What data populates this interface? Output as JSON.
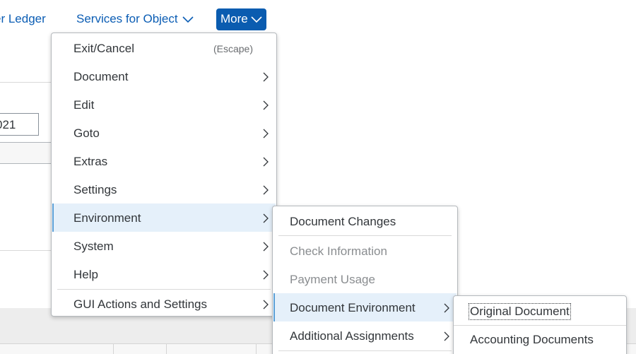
{
  "toolbar": {
    "ledger_link": "er Ledger",
    "services_link": "Services for Object",
    "more_button": "More"
  },
  "background": {
    "field_value": "021"
  },
  "main_menu": {
    "items": [
      {
        "label": "Exit/Cancel",
        "shortcut": "(Escape)"
      },
      {
        "label": "Document"
      },
      {
        "label": "Edit"
      },
      {
        "label": "Goto"
      },
      {
        "label": "Extras"
      },
      {
        "label": "Settings"
      },
      {
        "label": "Environment"
      },
      {
        "label": "System"
      },
      {
        "label": "Help"
      },
      {
        "label": "GUI Actions and Settings"
      }
    ]
  },
  "environment_menu": {
    "items": [
      {
        "label": "Document Changes"
      },
      {
        "label": "Check Information"
      },
      {
        "label": "Payment Usage"
      },
      {
        "label": "Document Environment"
      },
      {
        "label": "Additional Assignments"
      }
    ]
  },
  "document_environment_menu": {
    "items": [
      {
        "label": "Original Document"
      },
      {
        "label": "Accounting Documents"
      }
    ]
  },
  "colors": {
    "accent": "#0a5cb0",
    "link": "#0b5db4",
    "active_row": "#e5f0fa",
    "footer": "#ededed"
  },
  "icons": [
    "chevron-down-icon",
    "chevron-right-icon"
  ]
}
